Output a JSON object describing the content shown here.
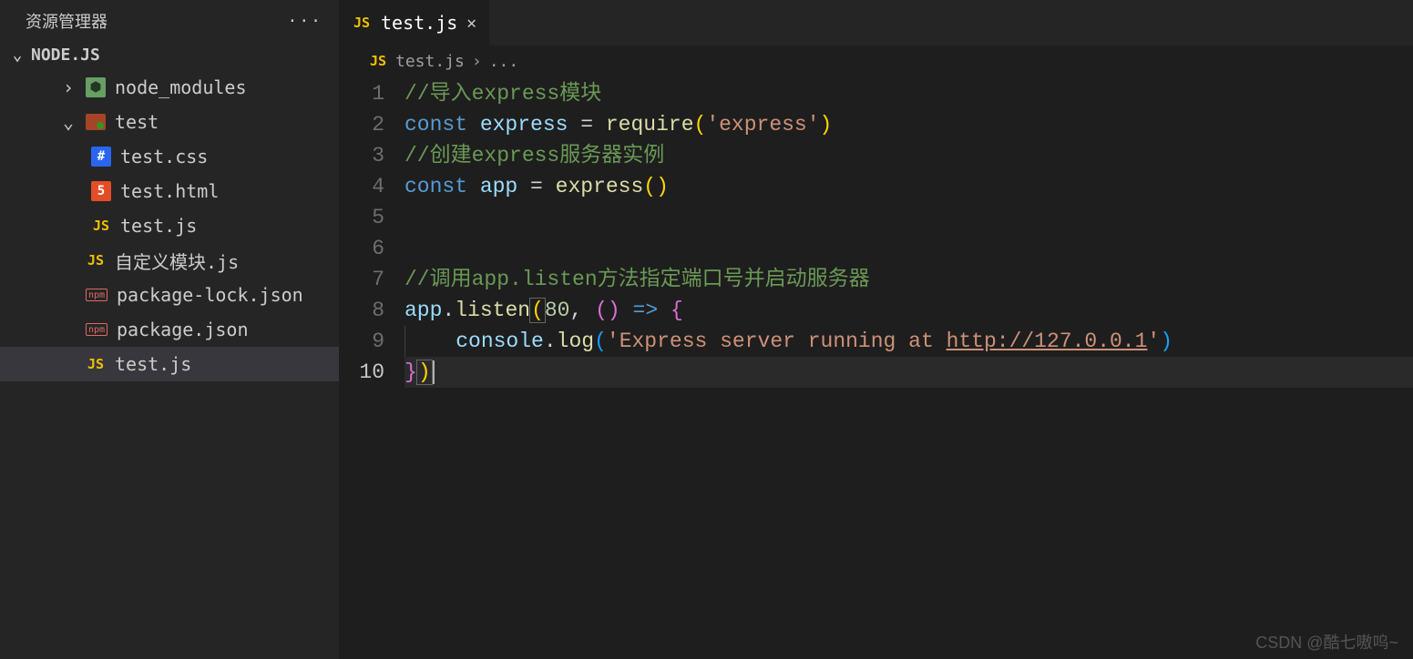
{
  "sidebar": {
    "title": "资源管理器",
    "project": "NODE.JS",
    "items": [
      {
        "icon": "node",
        "label": "node_modules",
        "depth": 2,
        "chev": "right",
        "selected": false
      },
      {
        "icon": "test",
        "label": "test",
        "depth": 2,
        "chev": "down",
        "selected": false
      },
      {
        "icon": "css",
        "label": "test.css",
        "depth": 3,
        "chev": "",
        "selected": false
      },
      {
        "icon": "html",
        "label": "test.html",
        "depth": 3,
        "chev": "",
        "selected": false
      },
      {
        "icon": "js",
        "label": "test.js",
        "depth": 3,
        "chev": "",
        "selected": false
      },
      {
        "icon": "js",
        "label": "自定义模块.js",
        "depth": 2,
        "chev": "",
        "selected": false
      },
      {
        "icon": "json",
        "label": "package-lock.json",
        "depth": 2,
        "chev": "",
        "selected": false
      },
      {
        "icon": "json",
        "label": "package.json",
        "depth": 2,
        "chev": "",
        "selected": false
      },
      {
        "icon": "js",
        "label": "test.js",
        "depth": 2,
        "chev": "",
        "selected": true
      }
    ]
  },
  "tabs": {
    "active": {
      "label": "test.js"
    }
  },
  "breadcrumb": {
    "file": "test.js",
    "tail": "..."
  },
  "code": {
    "lineCount": 10,
    "currentLine": 10,
    "lines": [
      [
        {
          "t": "//导入express模块",
          "c": "tk-comment"
        }
      ],
      [
        {
          "t": "const ",
          "c": "tk-keyword"
        },
        {
          "t": "express",
          "c": "tk-var"
        },
        {
          "t": " = ",
          "c": "tk-op"
        },
        {
          "t": "require",
          "c": "tk-func"
        },
        {
          "t": "(",
          "c": "tk-brace1"
        },
        {
          "t": "'express'",
          "c": "tk-string"
        },
        {
          "t": ")",
          "c": "tk-brace1"
        }
      ],
      [
        {
          "t": "//创建express服务器实例",
          "c": "tk-comment"
        }
      ],
      [
        {
          "t": "const ",
          "c": "tk-keyword"
        },
        {
          "t": "app",
          "c": "tk-var"
        },
        {
          "t": " = ",
          "c": "tk-op"
        },
        {
          "t": "express",
          "c": "tk-func"
        },
        {
          "t": "(",
          "c": "tk-brace1"
        },
        {
          "t": ")",
          "c": "tk-brace1"
        }
      ],
      [],
      [],
      [
        {
          "t": "//调用app.listen方法指定端口号并启动服务器",
          "c": "tk-comment"
        }
      ],
      [
        {
          "t": "app",
          "c": "tk-ident"
        },
        {
          "t": ".",
          "c": "tk-op"
        },
        {
          "t": "listen",
          "c": "tk-func"
        },
        {
          "t": "(",
          "c": "tk-brace1 bracket-box"
        },
        {
          "t": "80",
          "c": "tk-num"
        },
        {
          "t": ", ",
          "c": "tk-op"
        },
        {
          "t": "(",
          "c": "tk-brace2"
        },
        {
          "t": ")",
          "c": "tk-brace2"
        },
        {
          "t": " ",
          "c": "tk-op"
        },
        {
          "t": "=>",
          "c": "tk-keyword"
        },
        {
          "t": " ",
          "c": "tk-op"
        },
        {
          "t": "{",
          "c": "tk-brace2"
        }
      ],
      [
        {
          "t": "    ",
          "c": "tk-op"
        },
        {
          "t": "console",
          "c": "tk-ident"
        },
        {
          "t": ".",
          "c": "tk-op"
        },
        {
          "t": "log",
          "c": "tk-func"
        },
        {
          "t": "(",
          "c": "tk-brace3"
        },
        {
          "t": "'Express server running at ",
          "c": "tk-string"
        },
        {
          "t": "http://127.0.0.1",
          "c": "tk-link"
        },
        {
          "t": "'",
          "c": "tk-string"
        },
        {
          "t": ")",
          "c": "tk-brace3"
        }
      ],
      [
        {
          "t": "}",
          "c": "tk-brace2"
        },
        {
          "t": ")",
          "c": "tk-brace1 bracket-box"
        }
      ]
    ]
  },
  "watermark": "CSDN @酷七嗷呜~"
}
